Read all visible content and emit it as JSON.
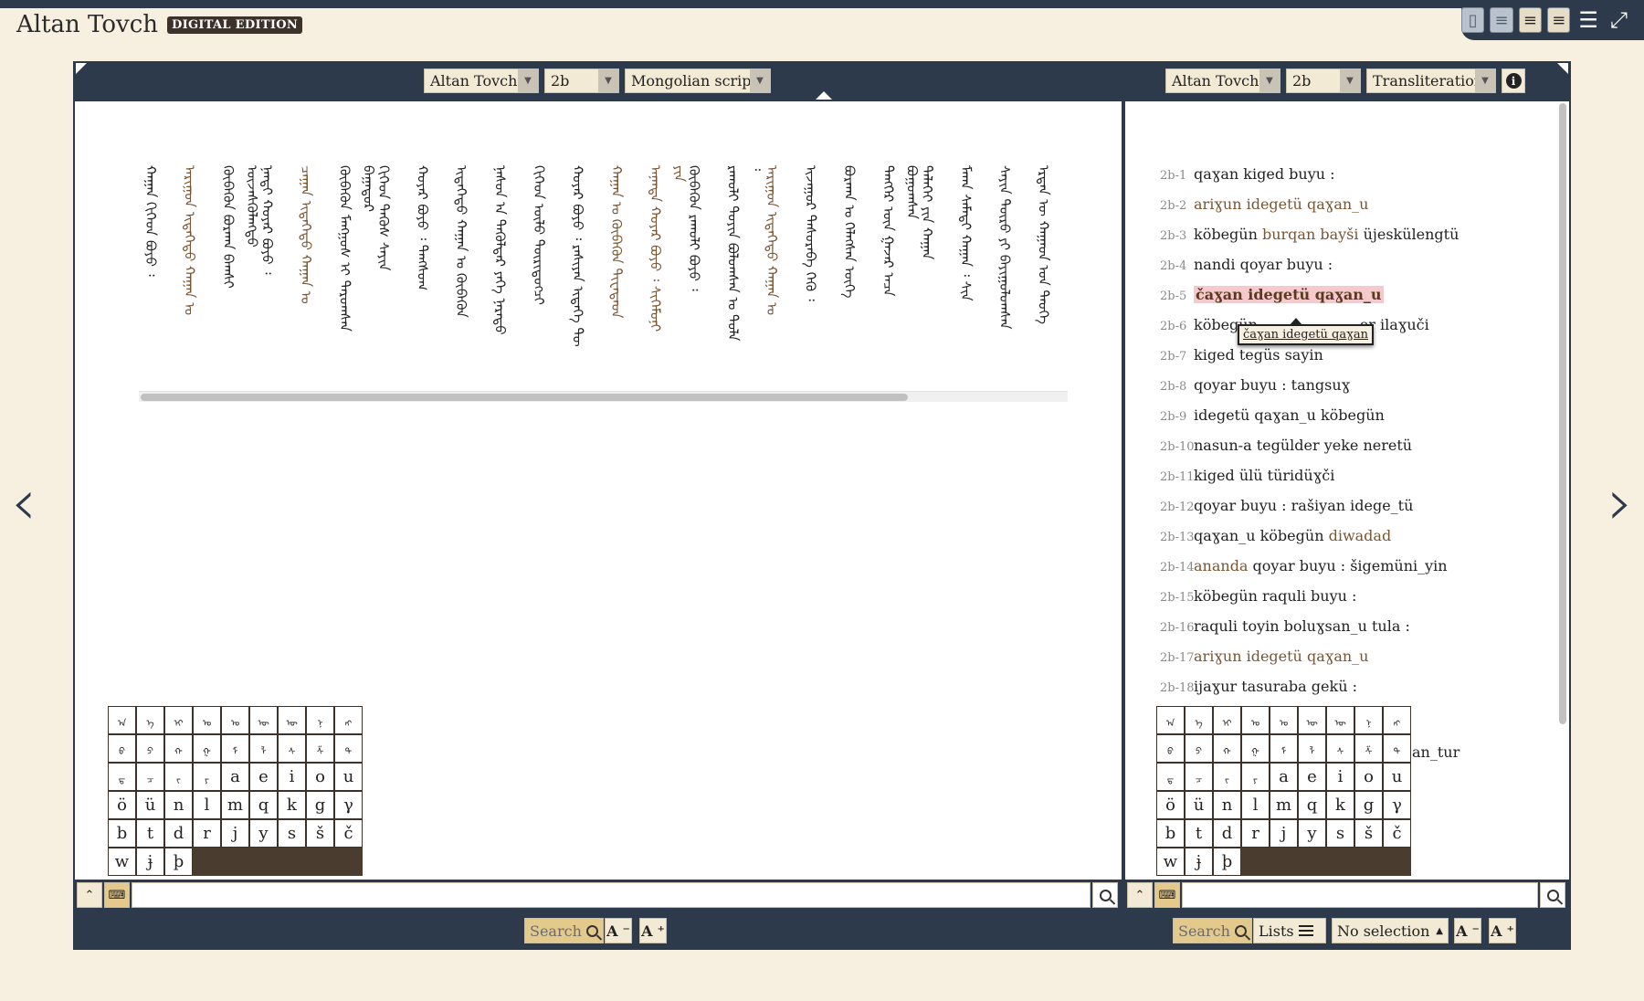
{
  "app": {
    "title": "Altan Tovch",
    "badge": "DIGITAL EDITION"
  },
  "layout_buttons": [
    "single-view-icon",
    "text-view-icon",
    "two-text-view-icon",
    "parallel-view-icon"
  ],
  "nav": {
    "prev": "‹",
    "next": "›"
  },
  "left_panel": {
    "text_select": "Altan Tovch",
    "page_select": "2b",
    "mode_select": "Mongolian script",
    "columns": [
      {
        "text": "ᠬᠠᠭᠠᠨ ᠬᠢᠭᠡᠳ ᠪᠤᠶᠤ ᠄",
        "hl": false
      },
      {
        "text": "ᠠᠷᠢᠭᠤᠨ ᠢᠳᠡᠭᠡᠲᠦ ᠬᠠᠭᠠᠨ ᠤ",
        "hl": true
      },
      {
        "text": "ᠬᠥᠪᠡᠭᠦᠨ ᠪᠤᠷᠬᠠᠨ ᠪᠠᠭᠰᠢ ᠦᠵᠡᠰᠬᠦᠯᠡᠩᠲᠦ",
        "hl": false
      },
      {
        "text": "ᠨᠠᠨᠳᠢ ᠬᠣᠶᠠᠷ ᠪᠤᠶᠤ ᠄",
        "hl": false
      },
      {
        "text": "ᠴᠠᠭᠠᠨ ᠢᠳᠡᠭᠡᠲᠦ ᠬᠠᠭᠠᠨ ᠤ",
        "hl": true
      },
      {
        "text": "ᠬᠥᠪᠡᠭᠦᠨ ᠮᠠᠩᠭᠤᠰ ᠢ ᠳᠠᠷᠤᠭᠰᠠᠨ ᠪᠠᠭᠠᠲᠤᠷ",
        "hl": false
      },
      {
        "text": "ᠬᠢᠭᠡᠳ ᠲᠡᠭᠦᠰ ᠰᠠᠶᠢᠨ",
        "hl": false
      },
      {
        "text": "ᠬᠣᠶᠠᠷ ᠪᠤᠶᠤ ᠄ ᠲᠠᠩᠰᠤᠭ",
        "hl": false
      },
      {
        "text": "ᠢᠳᠡᠭᠡᠲᠦ ᠬᠠᠭᠠᠨ ᠤ ᠬᠥᠪᠡᠭᠦᠨ",
        "hl": false
      },
      {
        "text": "ᠨᠠᠰᠤᠨ ᠠ ᠲᠡᠭᠦᠯᠳᠡᠷ ᠶᠡᠬᠡ ᠨᠡᠷᠡᠲᠦ",
        "hl": false
      },
      {
        "text": "ᠬᠢᠭᠡᠳ ᠦᠯᠦ ᠲᠦᠷᠢᠳᠦᠭᠴᠢ",
        "hl": false
      },
      {
        "text": "ᠬᠣᠶᠠᠷ ᠪᠤᠶᠤ ᠄ ᠷᠠᠰᠢᠶᠠᠨ ᠢᠳᠡᠭᠡ ᠲᠦ",
        "hl": false
      },
      {
        "text": "ᠬᠠᠭᠠᠨ ᠤ ᠬᠥᠪᠡᠭᠦᠨ ᠳᠢᠸᠠᠳᠠᠳ",
        "hl": true
      },
      {
        "text": "ᠠᠨᠠᠨᠳᠠ ᠬᠣᠶᠠᠷ ᠪᠤᠶᠤ ᠄ ᠱᠢᠭᠡᠮᠦᠨᠢ ᠶᠢᠨ",
        "hl": true
      },
      {
        "text": "ᠬᠥᠪᠡᠭᠦᠨ ᠷᠠᠬᠤᠯᠢ ᠪᠤᠶᠤ ᠄",
        "hl": false
      },
      {
        "text": "ᠷᠠᠬᠤᠯᠢ ᠲᠣᠶᠢᠨ ᠪᠣᠯᠤᠭᠰᠠᠨ ᠤ ᠲᠤᠯᠠ ᠄",
        "hl": false
      },
      {
        "text": "ᠠᠷᠢᠭᠤᠨ ᠢᠳᠡᠭᠡᠲᠦ ᠬᠠᠭᠠᠨ ᠤ",
        "hl": true
      },
      {
        "text": "ᠢᠵᠠᠭᠤᠷ ᠲᠠᠰᠤᠷᠠᠪᠠ ᠭᠡᠬᠦ ᠄",
        "hl": false
      },
      {
        "text": "ᠪᠤᠷᠬᠠᠨ ᠤ ᠬᠡᠯᠡᠭᠰᠡᠨ ᠦᠭᠡ",
        "hl": false
      },
      {
        "text": "ᠲᠡᠩᠭᠡᠷ ᠦᠨ ᠭᠠᠵᠠᠷ ᠠᠴᠠ ᠪᠤᠭᠤᠭᠰᠠᠨ",
        "hl": false
      },
      {
        "text": "ᠳᠡᠯᠡᠬᠡᠢ ᠶᠢᠨ ᠬᠠᠭᠠᠨ",
        "hl": false
      },
      {
        "text": "ᠮᠠᠬᠠ ᠰᠠᠮᠠᠳᠢ ᠬᠠᠭᠠᠨ ᠄ ᠰᠢᠨ",
        "hl": false
      },
      {
        "text": "ᠰᠠᠶᠢᠨ ᠲᠦᠷᠦ ᠶᠢ ᠪᠠᠶᠢᠭᠤᠯᠤᠭᠰᠠᠨ",
        "hl": false
      },
      {
        "text": "ᠡᠷᠲᠡᠨ ᠦ ᠬᠠᠭᠠᠳ ᠤᠨ ᠲᠡᠦᠬᠡ",
        "hl": false
      }
    ]
  },
  "right_panel": {
    "text_select": "Altan Tovch",
    "page_select": "2b",
    "mode_select": "Transliteration",
    "info_label": "i",
    "lines": [
      {
        "n": "2b-1",
        "parts": [
          {
            "t": "qaɣan kiged buyu :",
            "s": ""
          }
        ]
      },
      {
        "n": "2b-2",
        "parts": [
          {
            "t": "ariɣun idegetü qaɣan_u",
            "s": "brown"
          }
        ]
      },
      {
        "n": "2b-3",
        "parts": [
          {
            "t": "köbegün ",
            "s": ""
          },
          {
            "t": "burqan bayši",
            "s": "brown"
          },
          {
            "t": " üjeskülengtü",
            "s": ""
          }
        ]
      },
      {
        "n": "2b-4",
        "parts": [
          {
            "t": "nandi qoyar buyu :",
            "s": ""
          }
        ]
      },
      {
        "n": "2b-5",
        "parts": [
          {
            "t": "čaɣan idegetü qaɣan_u",
            "s": "mark"
          }
        ]
      },
      {
        "n": "2b-6",
        "parts": [
          {
            "t": "köbegün                      er ilaɣuči",
            "s": ""
          }
        ]
      },
      {
        "n": "2b-7",
        "parts": [
          {
            "t": "kiged tegüs sayin",
            "s": ""
          }
        ]
      },
      {
        "n": "2b-8",
        "parts": [
          {
            "t": "qoyar buyu : tangsuɣ",
            "s": ""
          }
        ]
      },
      {
        "n": "2b-9",
        "parts": [
          {
            "t": "idegetü qaɣan_u köbegün",
            "s": ""
          }
        ]
      },
      {
        "n": "2b-10",
        "parts": [
          {
            "t": "nasun-a tegülder yeke neretü",
            "s": ""
          }
        ]
      },
      {
        "n": "2b-11",
        "parts": [
          {
            "t": "kiged ülü türidüɣči",
            "s": ""
          }
        ]
      },
      {
        "n": "2b-12",
        "parts": [
          {
            "t": "qoyar buyu : rašiyan idege_tü",
            "s": ""
          }
        ]
      },
      {
        "n": "2b-13",
        "parts": [
          {
            "t": "qaɣan_u köbegün ",
            "s": ""
          },
          {
            "t": "diwadad",
            "s": "brown"
          }
        ]
      },
      {
        "n": "2b-14",
        "parts": [
          {
            "t": "ananda",
            "s": "brown"
          },
          {
            "t": " qoyar buyu : šigemüni_yin",
            "s": ""
          }
        ]
      },
      {
        "n": "2b-15",
        "parts": [
          {
            "t": "köbegün raquli buyu :",
            "s": ""
          }
        ]
      },
      {
        "n": "2b-16",
        "parts": [
          {
            "t": "raquli toyin boluɣsan_u tula :",
            "s": ""
          }
        ]
      },
      {
        "n": "2b-17",
        "parts": [
          {
            "t": "ariɣun idegetü qaɣan_u",
            "s": "brown"
          }
        ]
      },
      {
        "n": "2b-18",
        "parts": [
          {
            "t": "ijaɣur tasuraba gekü :",
            "s": ""
          }
        ]
      }
    ],
    "cut_text": "an_tur",
    "tooltip": "čaɣan idegetü qaɣan"
  },
  "keyboard": {
    "mongol_keys": [
      "ᠠ",
      "ᠡ",
      "ᠢ",
      "ᠣ",
      "ᠤ",
      "ᠥ",
      "ᠦ",
      "ᠨ",
      "ᠩ",
      "ᠪ",
      "ᠫ",
      "ᠬ",
      "ᠭ",
      "ᠮ",
      "ᠯ",
      "ᠰ",
      "ᠱ",
      "ᠲ",
      "ᠳ",
      "ᠴ",
      "ᠵ",
      "ᠶ",
      "ᠷ",
      "ᠸ",
      "ᠹ",
      "ᠺ",
      "ᠻ"
    ],
    "latin_keys": [
      "a",
      "e",
      "i",
      "o",
      "u",
      "ö",
      "ü",
      "n",
      "l",
      "m",
      "q",
      "k",
      "g",
      "γ",
      "b",
      "t",
      "d",
      "r",
      "j",
      "y",
      "s",
      "š",
      "č",
      "w",
      "ɉ",
      "þ"
    ]
  },
  "footer_left": {
    "search": "Search",
    "font_down": "A",
    "font_up": "A"
  },
  "footer_right": {
    "search": "Search",
    "lists": "Lists",
    "selection": "No selection",
    "font_down": "A",
    "font_up": "A"
  }
}
